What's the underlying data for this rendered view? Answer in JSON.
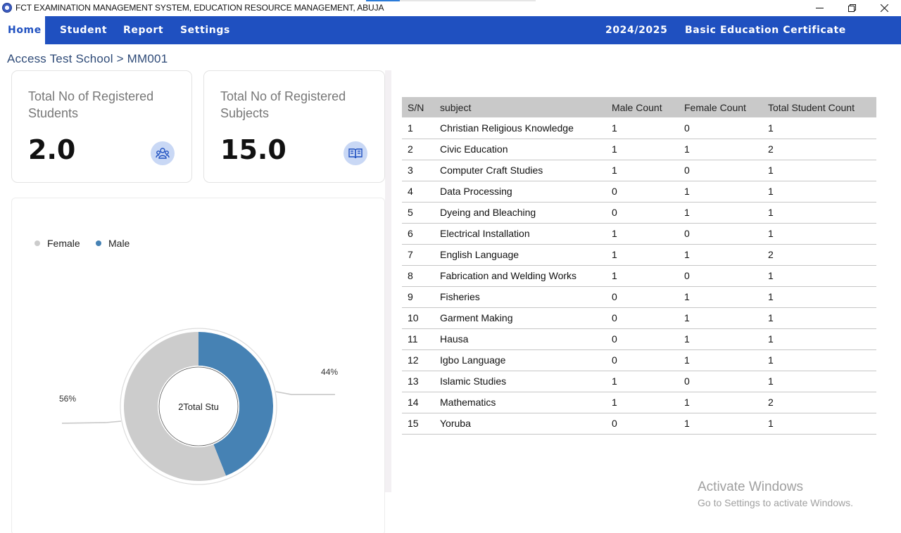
{
  "window": {
    "title": "FCT EXAMINATION MANAGEMENT SYSTEM, EDUCATION RESOURCE MANAGEMENT, ABUJA"
  },
  "nav": {
    "items": [
      {
        "label": "Home"
      },
      {
        "label": "Student"
      },
      {
        "label": "Report"
      },
      {
        "label": "Settings"
      }
    ],
    "session": "2024/2025",
    "exam": "Basic Education Certificate Examination"
  },
  "breadcrumb": "Access Test School > MM001",
  "cards": {
    "students": {
      "label": "Total No of Registered Students",
      "value": "2.0",
      "icon": "students-icon"
    },
    "subjects": {
      "label": "Total No of Registered Subjects",
      "value": "15.0",
      "icon": "book-icon"
    }
  },
  "chart_data": {
    "type": "pie",
    "categories": [
      "Female",
      "Male"
    ],
    "values": [
      56,
      44
    ],
    "labels": [
      "56%",
      "44%"
    ],
    "center_text": "2Total Stu",
    "colors": {
      "Female": "#cccccc",
      "Male": "#4682b4"
    },
    "legend_position": "top-left"
  },
  "table": {
    "headers": [
      "S/N",
      "subject",
      "Male Count",
      "Female Count",
      "Total Student Count"
    ],
    "rows": [
      [
        "1",
        "Christian Religious Knowledge",
        "1",
        "0",
        "1"
      ],
      [
        "2",
        "Civic Education",
        "1",
        "1",
        "2"
      ],
      [
        "3",
        "Computer Craft Studies",
        "1",
        "0",
        "1"
      ],
      [
        "4",
        "Data Processing",
        "0",
        "1",
        "1"
      ],
      [
        "5",
        "Dyeing and Bleaching",
        "0",
        "1",
        "1"
      ],
      [
        "6",
        "Electrical Installation",
        "1",
        "0",
        "1"
      ],
      [
        "7",
        "English Language",
        "1",
        "1",
        "2"
      ],
      [
        "8",
        "Fabrication and Welding Works",
        "1",
        "0",
        "1"
      ],
      [
        "9",
        "Fisheries",
        "0",
        "1",
        "1"
      ],
      [
        "10",
        "Garment Making",
        "0",
        "1",
        "1"
      ],
      [
        "11",
        "Hausa",
        "0",
        "1",
        "1"
      ],
      [
        "12",
        "Igbo Language",
        "0",
        "1",
        "1"
      ],
      [
        "13",
        "Islamic Studies",
        "1",
        "0",
        "1"
      ],
      [
        "14",
        "Mathematics",
        "1",
        "1",
        "2"
      ],
      [
        "15",
        "Yoruba",
        "0",
        "1",
        "1"
      ]
    ]
  },
  "watermark": {
    "line1": "Activate Windows",
    "line2": "Go to Settings to activate Windows."
  }
}
